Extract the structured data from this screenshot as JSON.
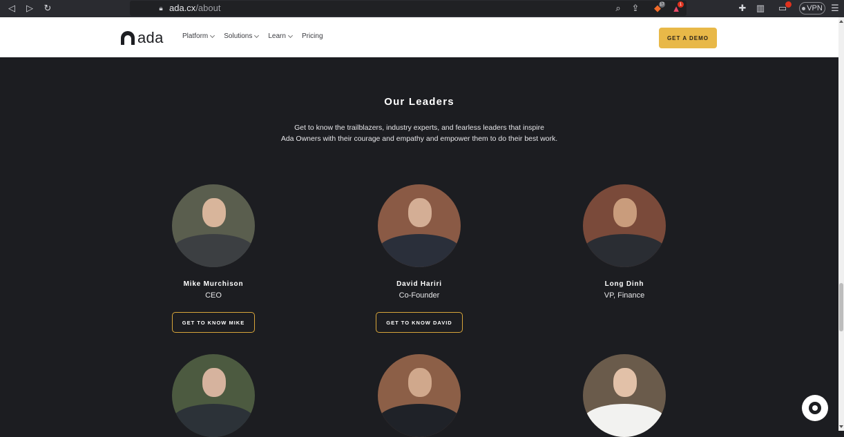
{
  "browser": {
    "url_host": "ada.cx",
    "url_path": "/about",
    "brave_count": "17",
    "alert_count": "1",
    "vpn_label": "VPN"
  },
  "header": {
    "logo_text": "ada",
    "nav": [
      {
        "label": "Platform"
      },
      {
        "label": "Solutions"
      },
      {
        "label": "Learn"
      },
      {
        "label": "Pricing"
      }
    ],
    "cta_label": "GET A DEMO"
  },
  "section": {
    "title": "Our Leaders",
    "intro_line1": "Get to know the trailblazers, industry experts, and fearless leaders that inspire",
    "intro_line2": "Ada Owners with their courage and empathy and empower them to do their best work."
  },
  "leaders": [
    {
      "name": "Mike Murchison",
      "role": "CEO",
      "button": "GET TO KNOW MIKE"
    },
    {
      "name": "David Hariri",
      "role": "Co-Founder",
      "button": "GET TO KNOW DAVID"
    },
    {
      "name": "Long Dinh",
      "role": "VP, Finance",
      "button": ""
    }
  ],
  "colors": {
    "background": "#1c1d21",
    "accent": "#e8b848",
    "button_border": "#d9a63a"
  }
}
